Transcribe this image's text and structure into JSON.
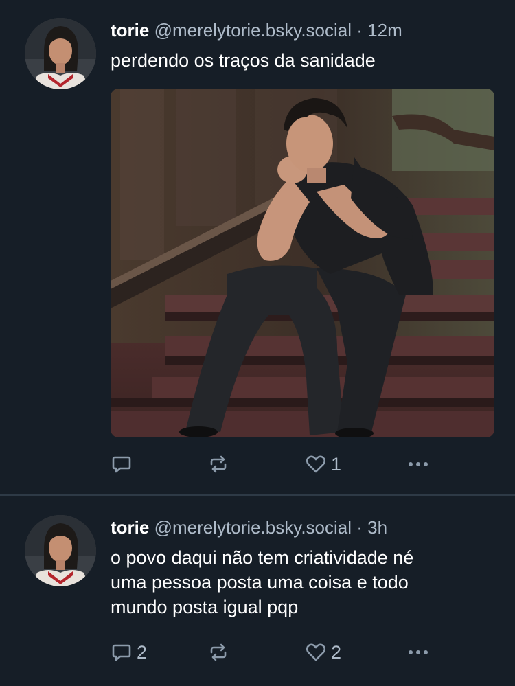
{
  "posts": [
    {
      "author": {
        "display_name": "torie",
        "handle": "@merelytorie.bsky.social",
        "avatar_icon": "user-avatar"
      },
      "separator": "·",
      "time": "12m",
      "text_lines": [
        "perdendo os traços da sanidade"
      ],
      "has_image": true,
      "actions": {
        "reply_count": "",
        "like_count": "1"
      }
    },
    {
      "author": {
        "display_name": "torie",
        "handle": "@merelytorie.bsky.social",
        "avatar_icon": "user-avatar"
      },
      "separator": "·",
      "time": "3h",
      "text_lines": [
        "o povo daqui não tem criatividade né",
        "uma pessoa posta uma coisa e todo",
        "mundo posta igual pqp"
      ],
      "has_image": false,
      "actions": {
        "reply_count": "2",
        "like_count": "2"
      }
    }
  ],
  "icons": {
    "reply": "reply-icon",
    "repost": "repost-icon",
    "like": "heart-icon",
    "more": "more-options-icon"
  },
  "colors": {
    "background": "#161e27",
    "divider": "#2e3a46",
    "text": "#ffffff",
    "muted": "#aebbc9",
    "icon": "#8c9bab"
  }
}
